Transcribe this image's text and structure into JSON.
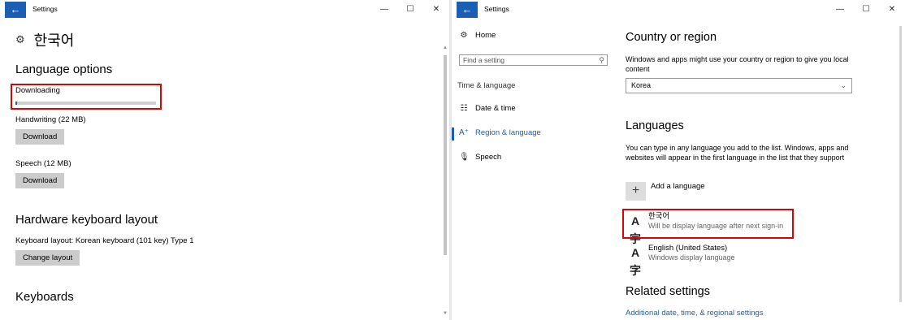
{
  "window1": {
    "title": "Settings",
    "page_title": "한국어",
    "sections": {
      "language_options": "Language options",
      "hardware_keyboard": "Hardware keyboard layout",
      "keyboards": "Keyboards"
    },
    "downloading": {
      "label": "Downloading",
      "progress": 0.01
    },
    "handwriting": {
      "label": "Handwriting (22 MB)",
      "button": "Download"
    },
    "speech": {
      "label": "Speech (12 MB)",
      "button": "Download"
    },
    "keyboard_layout": {
      "label": "Keyboard layout:  Korean keyboard (101 key) Type 1",
      "button": "Change layout"
    }
  },
  "window2": {
    "title": "Settings",
    "nav": {
      "home": "Home",
      "search_placeholder": "Find a setting",
      "group": "Time & language",
      "items": [
        {
          "label": "Date & time",
          "icon": "calendar-clock-icon",
          "active": false
        },
        {
          "label": "Region & language",
          "icon": "language-icon",
          "active": true
        },
        {
          "label": "Speech",
          "icon": "microphone-icon",
          "active": false
        }
      ]
    },
    "country": {
      "heading": "Country or region",
      "description": "Windows and apps might use your country or region to give you local content",
      "selected": "Korea"
    },
    "languages": {
      "heading": "Languages",
      "description": "You can type in any language you add to the list. Windows, apps and websites will appear in the first language in the list that they support",
      "add_label": "Add a language",
      "items": [
        {
          "name": "한국어",
          "status": "Will be display language after next sign-in"
        },
        {
          "name": "English (United States)",
          "status": "Windows display language"
        }
      ]
    },
    "related": {
      "heading": "Related settings",
      "link": "Additional date, time, & regional settings"
    }
  },
  "colors": {
    "accent": "#1a5fb4",
    "highlight": "#e00000",
    "button_bg": "#cccccc"
  }
}
